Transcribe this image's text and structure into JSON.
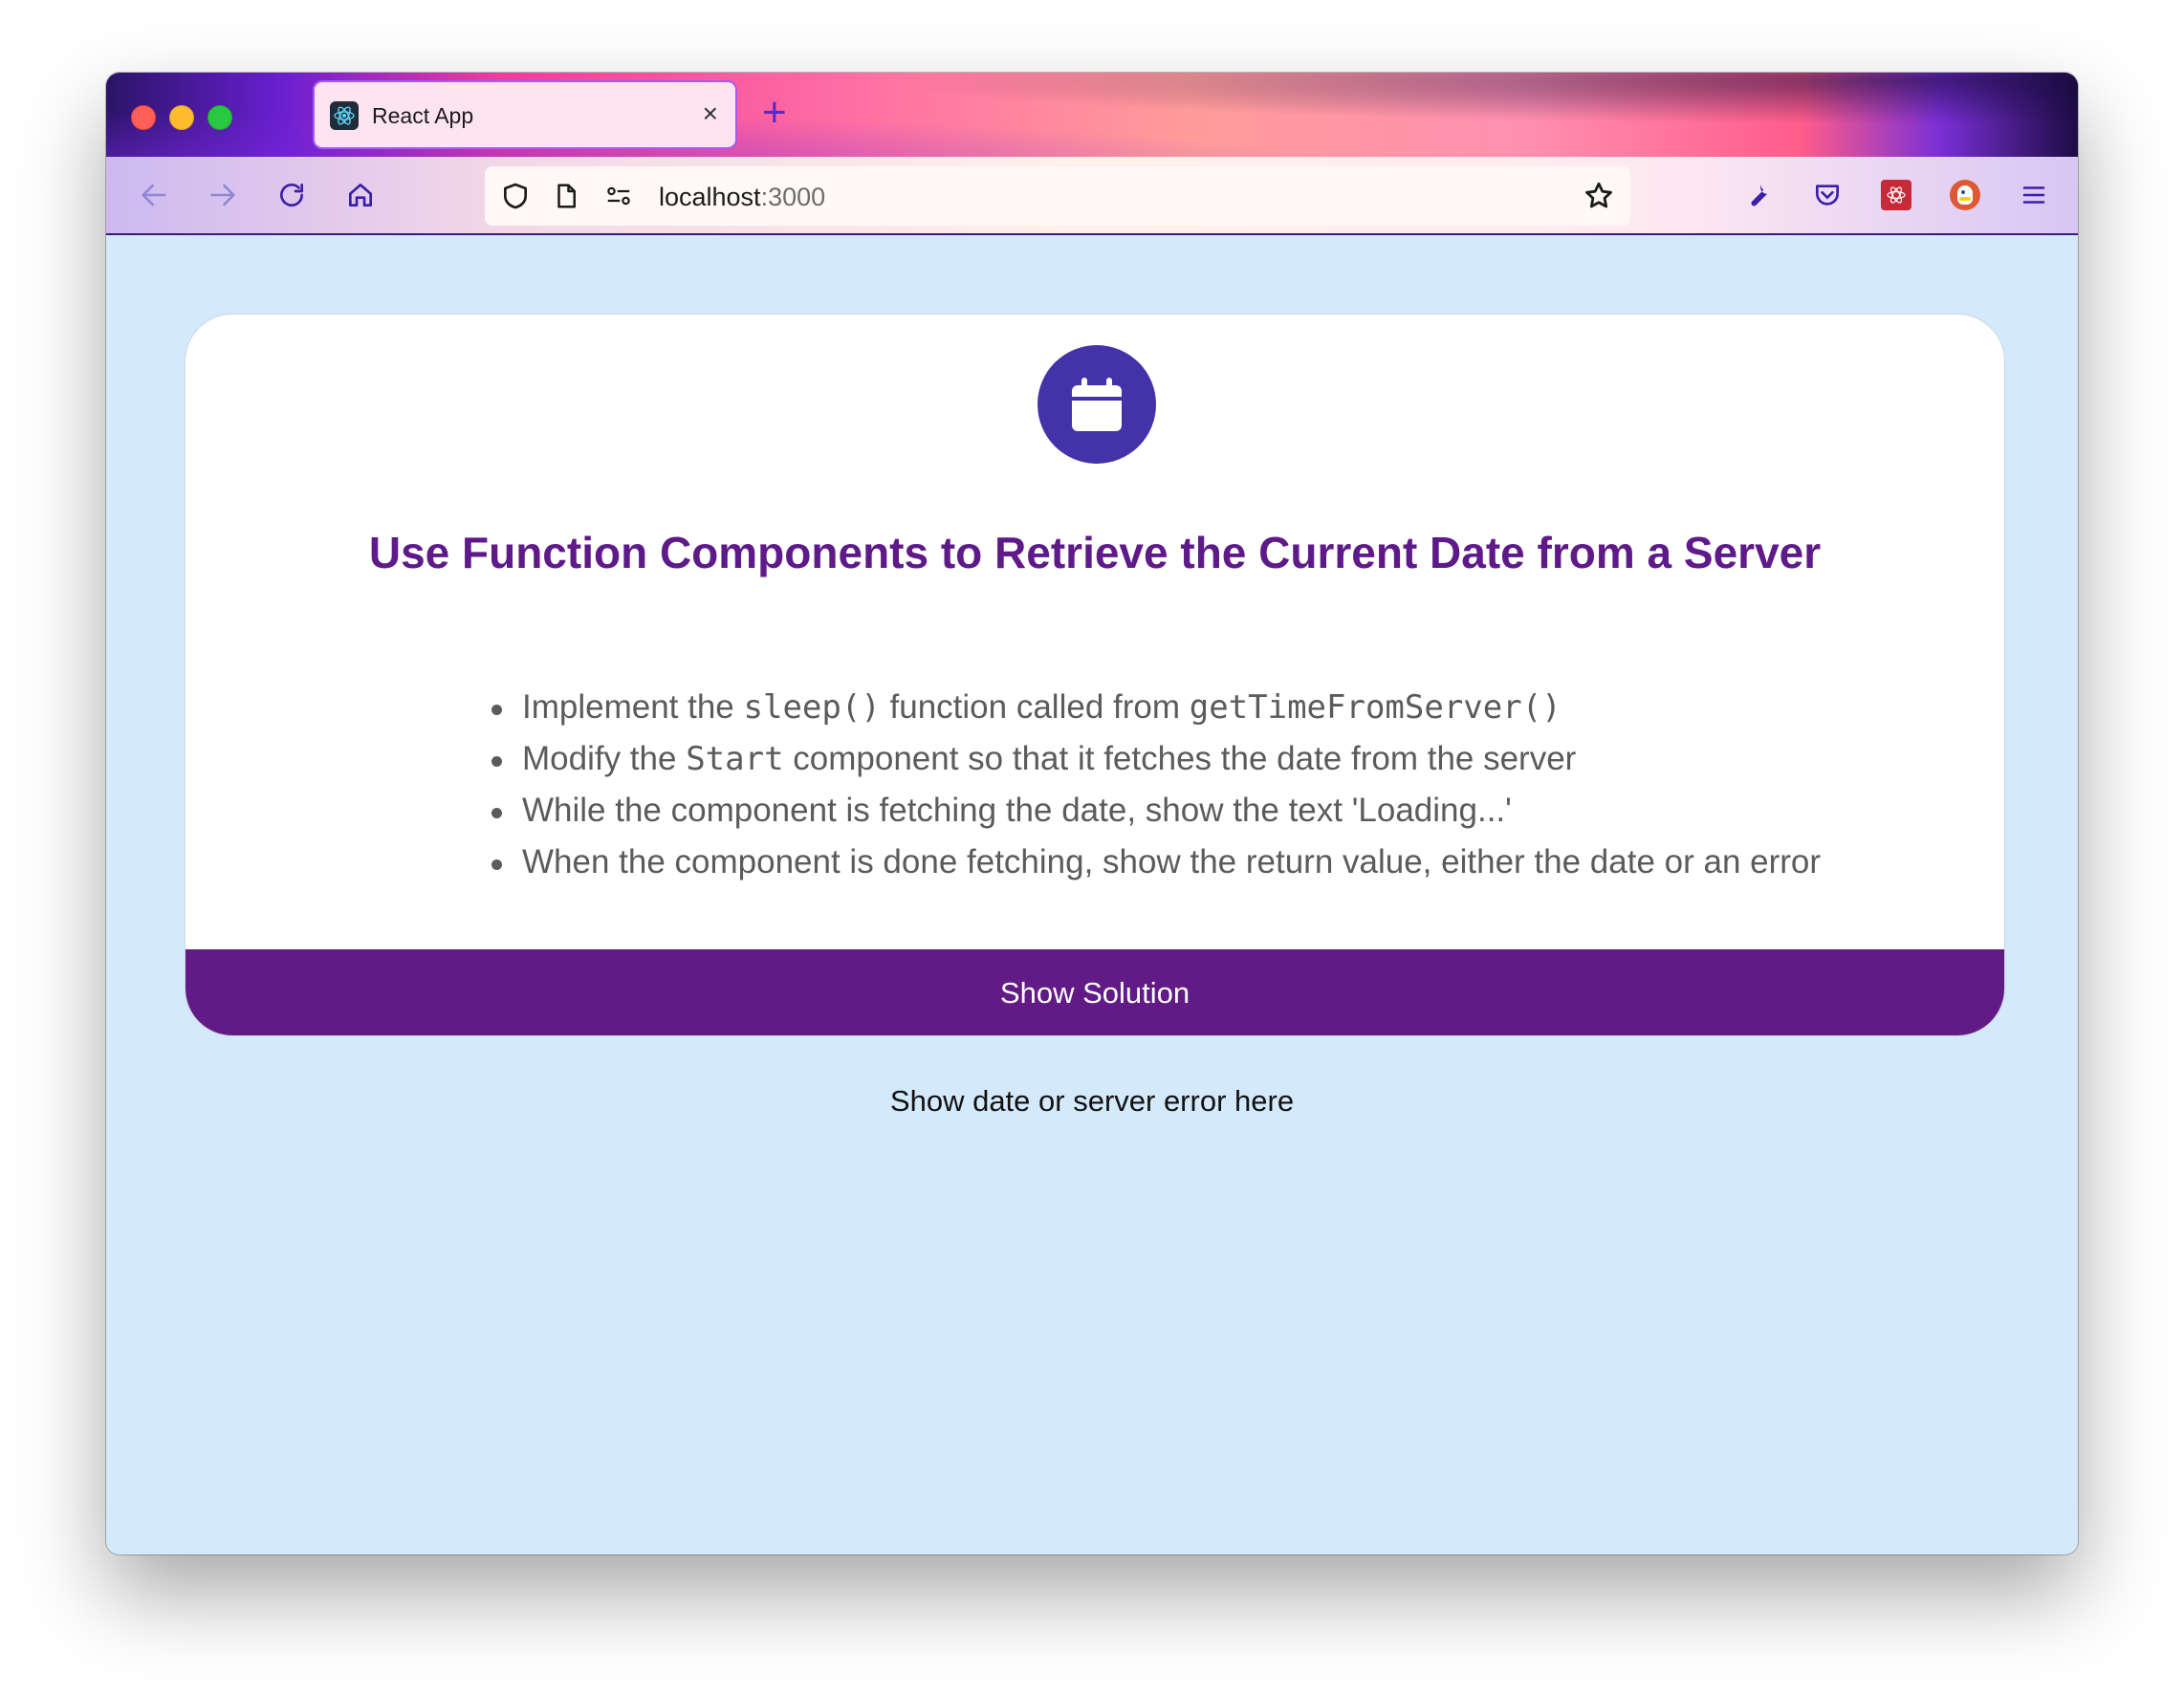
{
  "browser": {
    "tab_title": "React App",
    "tab_close": "×",
    "new_tab": "+",
    "url_host": "localhost",
    "url_port": ":3000"
  },
  "card": {
    "title": "Use Function Components to Retrieve the Current Date from a Server",
    "bullets": [
      {
        "pre": "Implement the ",
        "code1": "sleep()",
        "mid": " function called from ",
        "code2": "getTimeFromServer()",
        "post": ""
      },
      {
        "pre": "Modify the ",
        "code1": "Start",
        "mid": " component so that it fetches the date from the server"
      },
      {
        "text": "While the component is fetching the date, show the text 'Loading...'"
      },
      {
        "text": "When the component is done fetching, show the return value, either the date or an error"
      }
    ],
    "button_label": "Show Solution"
  },
  "result": {
    "text": "Show date or server error here"
  },
  "colors": {
    "page_bg": "#d4e9fc",
    "title": "#5f1a8a",
    "button_bg": "#621a87",
    "icon_circle": "#4433a8"
  },
  "icons": [
    "back-icon",
    "forward-icon",
    "reload-icon",
    "home-icon",
    "shield-icon",
    "page-icon",
    "permissions-icon",
    "star-icon",
    "wrench-icon",
    "pocket-icon",
    "extension-icon",
    "duckduckgo-icon",
    "menu-icon",
    "calendar-icon",
    "react-logo-icon"
  ]
}
